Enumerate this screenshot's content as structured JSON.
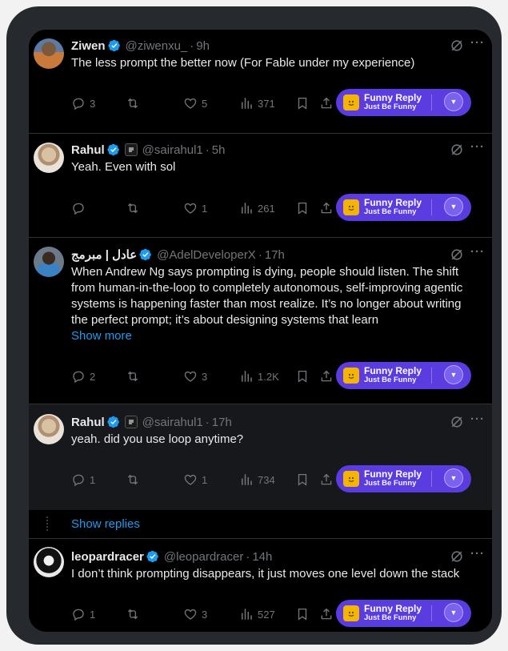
{
  "funny_reply": {
    "title": "Funny Reply",
    "subtitle": "Just Be Funny"
  },
  "show_replies_label": "Show replies",
  "show_more_label": "Show more",
  "posts": [
    {
      "name": "Ziwen",
      "handle": "@ziwenxu_",
      "time": "9h",
      "text": "The less prompt the better now (For Fable under my experience)",
      "replies": "3",
      "reposts": "",
      "likes": "5",
      "views": "371"
    },
    {
      "name": "Rahul",
      "handle": "@sairahul1",
      "time": "5h",
      "text": "Yeah. Even with sol",
      "replies": "",
      "reposts": "",
      "likes": "1",
      "views": "261"
    },
    {
      "name": "عادل | مبرمج",
      "handle": "@AdelDeveloperX",
      "time": "17h",
      "text": "When Andrew Ng says prompting is dying, people should listen. The shift from human-in-the-loop to completely autonomous, self-improving agentic systems is happening faster than most realize. It’s no longer about writing the perfect prompt; it’s about designing systems that learn",
      "replies": "2",
      "reposts": "",
      "likes": "3",
      "views": "1.2K"
    },
    {
      "name": "Rahul",
      "handle": "@sairahul1",
      "time": "17h",
      "text": "yeah. did you use loop anytime?",
      "replies": "1",
      "reposts": "",
      "likes": "1",
      "views": "734"
    },
    {
      "name": "leopardracer",
      "handle": "@leopardracer",
      "time": "14h",
      "text": "I don’t think prompting disappears, it just moves one level down the stack",
      "replies": "1",
      "reposts": "",
      "likes": "3",
      "views": "527"
    }
  ],
  "colors": {
    "accent": "#1d9bf0",
    "funny_bg": "#5a3ce0",
    "text": "#e7e9ea",
    "muted": "#71767b"
  }
}
